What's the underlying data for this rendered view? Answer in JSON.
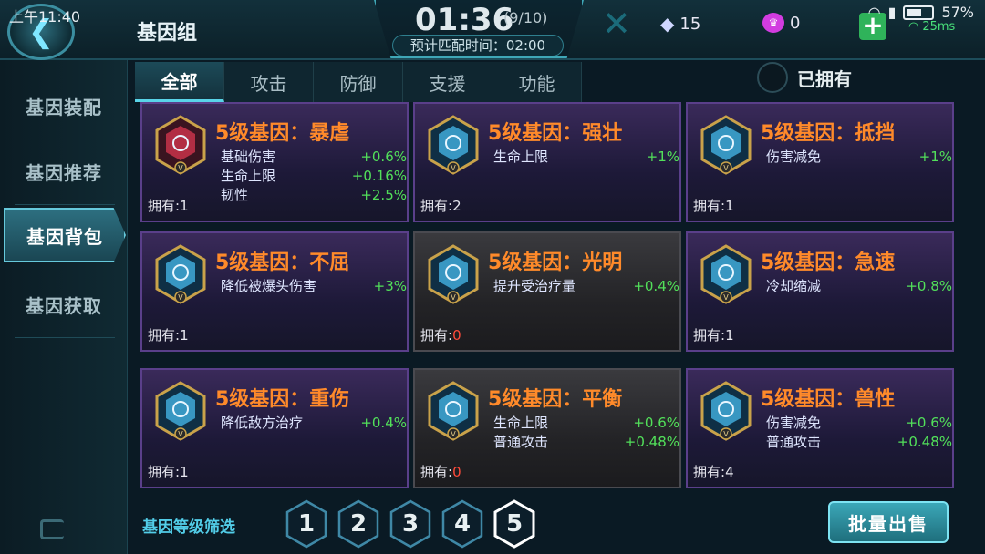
{
  "status_bar": {
    "time": "上午11:40",
    "battery": "57%"
  },
  "header": {
    "title": "基因组",
    "timer": "01:36",
    "timer_count": "(9/10)",
    "match_time": "预计匹配时间：02:00",
    "diamonds": "15",
    "gems": "0",
    "ping": "25ms"
  },
  "sidebar": {
    "items": [
      {
        "label": "基因装配"
      },
      {
        "label": "基因推荐"
      },
      {
        "label": "基因背包",
        "active": true
      },
      {
        "label": "基因获取"
      }
    ]
  },
  "tabs": [
    {
      "label": "全部",
      "active": true
    },
    {
      "label": "攻击"
    },
    {
      "label": "防御"
    },
    {
      "label": "支援"
    },
    {
      "label": "功能"
    }
  ],
  "owned_toggle": {
    "label": "已拥有"
  },
  "owned_prefix": "拥有:",
  "cards": [
    {
      "name": "5级基因：暴虐",
      "icon": "rage-gene-icon",
      "style": "purple",
      "owned": "1",
      "stats": [
        {
          "k": "基础伤害",
          "v": "+0.6%"
        },
        {
          "k": "生命上限",
          "v": "+0.16%"
        },
        {
          "k": "韧性",
          "v": "+2.5%"
        }
      ]
    },
    {
      "name": "5级基因：强壮",
      "icon": "strong-gene-icon",
      "style": "purple",
      "owned": "2",
      "stats": [
        {
          "k": "生命上限",
          "v": "+1%"
        }
      ]
    },
    {
      "name": "5级基因：抵挡",
      "icon": "block-gene-icon",
      "style": "purple",
      "owned": "1",
      "stats": [
        {
          "k": "伤害减免",
          "v": "+1%"
        }
      ]
    },
    {
      "name": "5级基因：不屈",
      "icon": "unyielding-gene-icon",
      "style": "purple",
      "owned": "1",
      "stats": [
        {
          "k": "降低被爆头伤害",
          "v": "+3%"
        }
      ]
    },
    {
      "name": "5级基因：光明",
      "icon": "light-gene-icon",
      "style": "gray",
      "owned": "0",
      "stats": [
        {
          "k": "提升受治疗量",
          "v": "+0.4%"
        }
      ]
    },
    {
      "name": "5级基因：急速",
      "icon": "haste-gene-icon",
      "style": "purple",
      "owned": "1",
      "stats": [
        {
          "k": "冷却缩减",
          "v": "+0.8%"
        }
      ]
    },
    {
      "name": "5级基因：重伤",
      "icon": "wound-gene-icon",
      "style": "purple",
      "owned": "1",
      "stats": [
        {
          "k": "降低敌方治疗",
          "v": "+0.4%"
        }
      ]
    },
    {
      "name": "5级基因：平衡",
      "icon": "balance-gene-icon",
      "style": "gray",
      "owned": "0",
      "stats": [
        {
          "k": "生命上限",
          "v": "+0.6%"
        },
        {
          "k": "普通攻击",
          "v": "+0.48%"
        }
      ]
    },
    {
      "name": "5级基因：兽性",
      "icon": "beast-gene-icon",
      "style": "purple",
      "owned": "4",
      "stats": [
        {
          "k": "伤害减免",
          "v": "+0.6%"
        },
        {
          "k": "普通攻击",
          "v": "+0.48%"
        }
      ]
    }
  ],
  "filter": {
    "label": "基因等级筛选",
    "levels": [
      "1",
      "2",
      "3",
      "4",
      "5"
    ],
    "selected": "5"
  },
  "sell_button": "批量出售",
  "colors": {
    "accent": "#59d4e8",
    "gene_name": "#ff8a2a",
    "stat_value": "#52e05a",
    "zero_owned": "#ff4a3a"
  }
}
